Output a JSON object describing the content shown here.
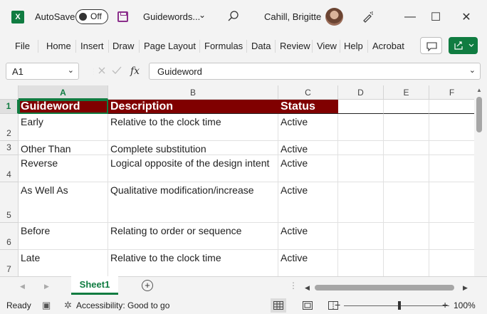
{
  "app": {
    "autosave_label": "AutoSave",
    "autosave_state": "Off",
    "doc_title": "Guidewords...",
    "user_name": "Cahill, Brigitte",
    "window_controls": {
      "minimize": "—",
      "maximize": "☐",
      "close": "✕"
    }
  },
  "ribbon": {
    "tabs": [
      "File",
      "Home",
      "Insert",
      "Draw",
      "Page Layout",
      "Formulas",
      "Data",
      "Review",
      "View",
      "Help",
      "Acrobat"
    ]
  },
  "formula_bar": {
    "name_box": "A1",
    "fx": "fx",
    "content": "Guideword"
  },
  "grid": {
    "columns": [
      "A",
      "B",
      "C",
      "D",
      "E",
      "F"
    ],
    "rows": [
      {
        "num": "1",
        "cells": [
          "Guideword",
          "Description",
          "Status"
        ]
      },
      {
        "num": "2",
        "cells": [
          "Early",
          "Relative to the clock time",
          "Active"
        ]
      },
      {
        "num": "3",
        "cells": [
          "Other Than",
          "Complete substitution",
          "Active"
        ]
      },
      {
        "num": "4",
        "cells": [
          "Reverse",
          "Logical opposite of the design intent",
          "Active"
        ]
      },
      {
        "num": "5",
        "cells": [
          "As Well As",
          "Qualitative modification/increase",
          "Active"
        ]
      },
      {
        "num": "6",
        "cells": [
          "Before",
          "Relating to order or sequence",
          "Active"
        ]
      },
      {
        "num": "7",
        "cells": [
          "Late",
          "Relative to the clock time",
          "Active"
        ]
      }
    ],
    "header_fill": "#800000"
  },
  "sheets": {
    "tabs": [
      "Sheet1"
    ],
    "add_label": "+"
  },
  "status": {
    "ready": "Ready",
    "accessibility": "Accessibility: Good to go",
    "zoom_minus": "−",
    "zoom_plus": "+",
    "zoom_percent": "100%"
  },
  "colors": {
    "accent": "#107c41",
    "header": "#800000"
  }
}
